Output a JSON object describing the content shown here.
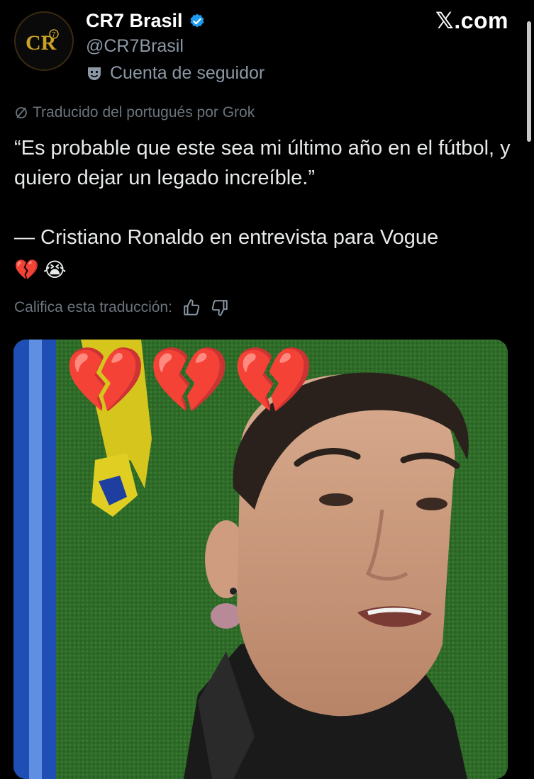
{
  "header": {
    "display_name": "CR7 Brasil",
    "handle": "@CR7Brasil",
    "account_label": "Cuenta de seguidor",
    "site": "𝕏.com",
    "avatar_text": "CR7"
  },
  "tweet": {
    "translation_label": "Traducido del portugués por Grok",
    "text": "“Es probable que este sea mi último año en el fútbol, y quiero dejar un legado increíble.”\n\n— Cristiano Ronaldo en entrevista para Vogue",
    "emojis": [
      "💔",
      "😭"
    ],
    "rate_label": "Califica esta traducción:"
  },
  "media": {
    "overlay_emojis": [
      "💔",
      "💔",
      "💔"
    ]
  },
  "colors": {
    "background": "#000000",
    "verified": "#1d9bf0",
    "muted": "#8b98a5",
    "grass": "#2f6b2a"
  }
}
